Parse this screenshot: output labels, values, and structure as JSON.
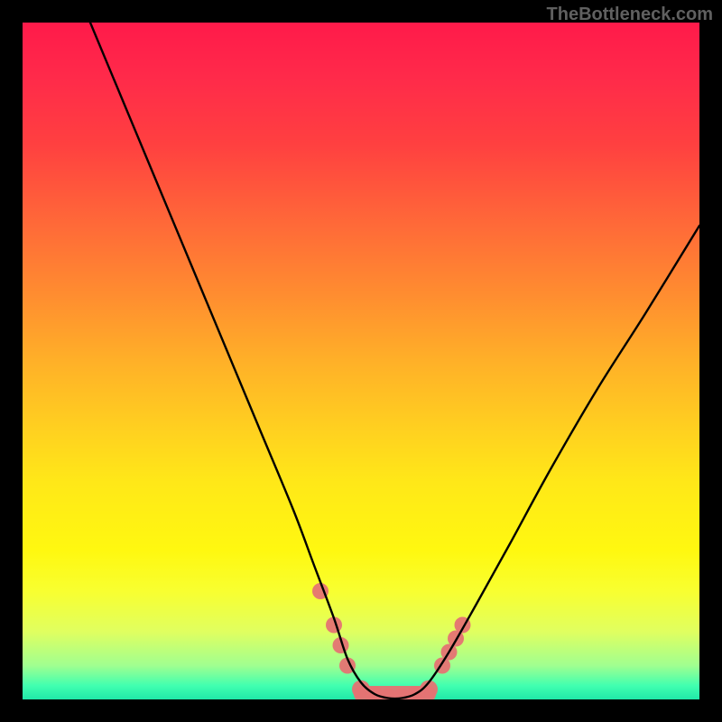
{
  "watermark": "TheBottleneck.com",
  "colors": {
    "frame": "#000000",
    "curve": "#000000",
    "markers": "#e57373",
    "gradient_top": "#ff1a4a",
    "gradient_bottom": "#20e8a8"
  },
  "chart_data": {
    "type": "line",
    "title": "",
    "xlabel": "",
    "ylabel": "",
    "xlim": [
      0,
      100
    ],
    "ylim": [
      0,
      100
    ],
    "grid": false,
    "description": "V-shaped bottleneck curve on rainbow gradient; y represents bottleneck percentage (red=high, green=low). Minimum near x≈52–58 at y≈0.",
    "series": [
      {
        "name": "bottleneck-curve",
        "x": [
          10,
          15,
          20,
          25,
          30,
          35,
          40,
          43,
          46,
          48,
          50,
          52,
          54,
          56,
          58,
          60,
          63,
          67,
          72,
          78,
          85,
          92,
          100
        ],
        "y": [
          100,
          88,
          76,
          64,
          52,
          40,
          28,
          20,
          12,
          6,
          2.5,
          0.8,
          0.2,
          0.2,
          0.8,
          2.5,
          7,
          14,
          23,
          34,
          46,
          57,
          70
        ]
      }
    ],
    "markers": [
      {
        "name": "left-cluster",
        "x": 44,
        "y": 16
      },
      {
        "name": "left-cluster",
        "x": 46,
        "y": 11
      },
      {
        "name": "left-cluster",
        "x": 47,
        "y": 8
      },
      {
        "name": "left-cluster",
        "x": 48,
        "y": 5
      },
      {
        "name": "flat-min",
        "x": 50,
        "y": 1.5
      },
      {
        "name": "flat-min",
        "x": 52,
        "y": 0.6
      },
      {
        "name": "flat-min",
        "x": 54,
        "y": 0.3
      },
      {
        "name": "flat-min",
        "x": 56,
        "y": 0.3
      },
      {
        "name": "flat-min",
        "x": 58,
        "y": 0.6
      },
      {
        "name": "flat-min",
        "x": 60,
        "y": 1.5
      },
      {
        "name": "right-cluster",
        "x": 62,
        "y": 5
      },
      {
        "name": "right-cluster",
        "x": 63,
        "y": 7
      },
      {
        "name": "right-cluster",
        "x": 64,
        "y": 9
      },
      {
        "name": "right-cluster",
        "x": 65,
        "y": 11
      }
    ]
  }
}
